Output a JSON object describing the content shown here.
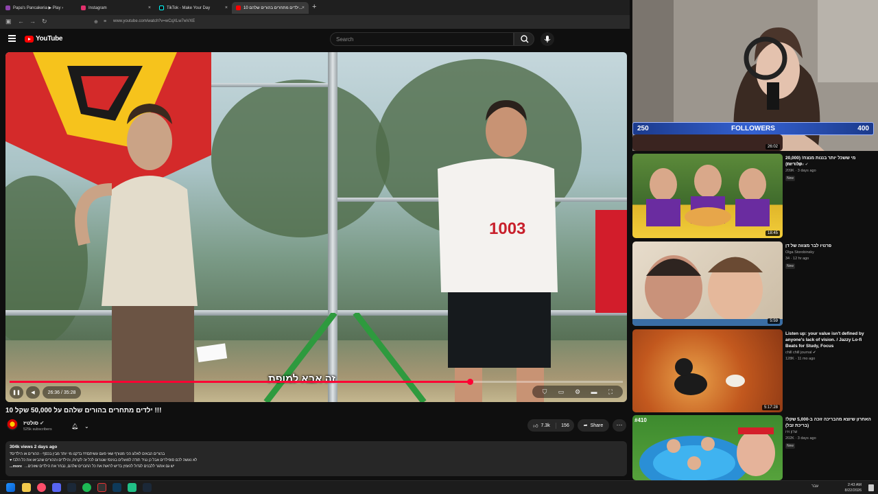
{
  "browser": {
    "tabs": [
      {
        "title": "Papa's Pancakeria ▶ Play ›",
        "favicon_color": "#8e44ad"
      },
      {
        "title": "Instagram",
        "favicon_color": "#e1306c"
      },
      {
        "title": "TikTok - Make Your Day",
        "favicon_color": "#111111"
      },
      {
        "title": "10 ילדים מתחרים בהורים שלהם...",
        "favicon_color": "#ff0000"
      }
    ],
    "close_glyph": "×",
    "new_tab_glyph": "+",
    "url": "www.youtube.com/watch?v=wCqXLw7wVXE"
  },
  "youtube": {
    "logo_text": "YouTube",
    "search_placeholder": "Search"
  },
  "player": {
    "caption": "זה אבא למופת",
    "time": "26:36 / 35:28",
    "progress_fraction": 0.75,
    "accent": "#ff0033"
  },
  "video": {
    "title": "ילדים מתחרים בהורים שלהם על 50,000 שקל 10 !!!",
    "channel": "סולטיז",
    "subscribers": "525k subscribers",
    "likes": "7.3k",
    "dislikes": "156",
    "share_label": "Share",
    "more_glyph": "⋯",
    "views_date": "304k views  2 days ago",
    "description_lines": [
      "בהורים הבאים לאלוג הכי מטורף שאי פעם עשיתם!!!! בדקנו מי יותר מבין בכסף - ההורים או הילדים?",
      "לא נעשה לכם סופילרים אבל כן נגיד תודה למועלים בגינס! שנגרום לכל זה לקרות, והילדים וההורים שהביאו את כל הלב! ♥",
      "יש גם אתגר ללבנים לגדול להזמין בדיש לראות את כל החברים שלהם, נבחר את הילדים שזוכים..."
    ],
    "more_label": "...more"
  },
  "stream": {
    "followers_label": "FOLLOWERS",
    "followers_current": "250",
    "followers_goal": "400",
    "bar_color": "#3461d1"
  },
  "recommendations": [
    {
      "duration": "26:02",
      "title": "",
      "channel": "",
      "stats": ""
    },
    {
      "duration": "18:45",
      "title": "מי ששכל יותר בננות מנצח! (20,000 קלוריות)",
      "channel": "Inde Game ✔",
      "stats": "209K · 3 days ago",
      "badge": "New"
    },
    {
      "duration": "5:59",
      "title": "פרנויו לבר מצווה של דן",
      "channel": "Olga Storobinsky",
      "stats": "34 · 12 hr ago",
      "badge": "New"
    },
    {
      "duration": "5:17:28",
      "title": "Listen up: your value isn't defined by anyone's lack of vision. / Jazzy Lo-fi Beats for Study, Focus",
      "channel": "chill chill journal ✔",
      "stats": "128K · 11 mo ago",
      "badge": ""
    },
    {
      "duration": "",
      "title": "האחרון שיוצא מהבריכה זוכה ב-5,000 שקל! (בריכת זבל)",
      "channel": "שרון וזיו",
      "stats": "202K · 3 days ago",
      "badge": "New",
      "tag": "#410"
    }
  ],
  "taskbar": {
    "time": "2:43 AM",
    "date": "8/22/2026",
    "lang": "עבר"
  }
}
